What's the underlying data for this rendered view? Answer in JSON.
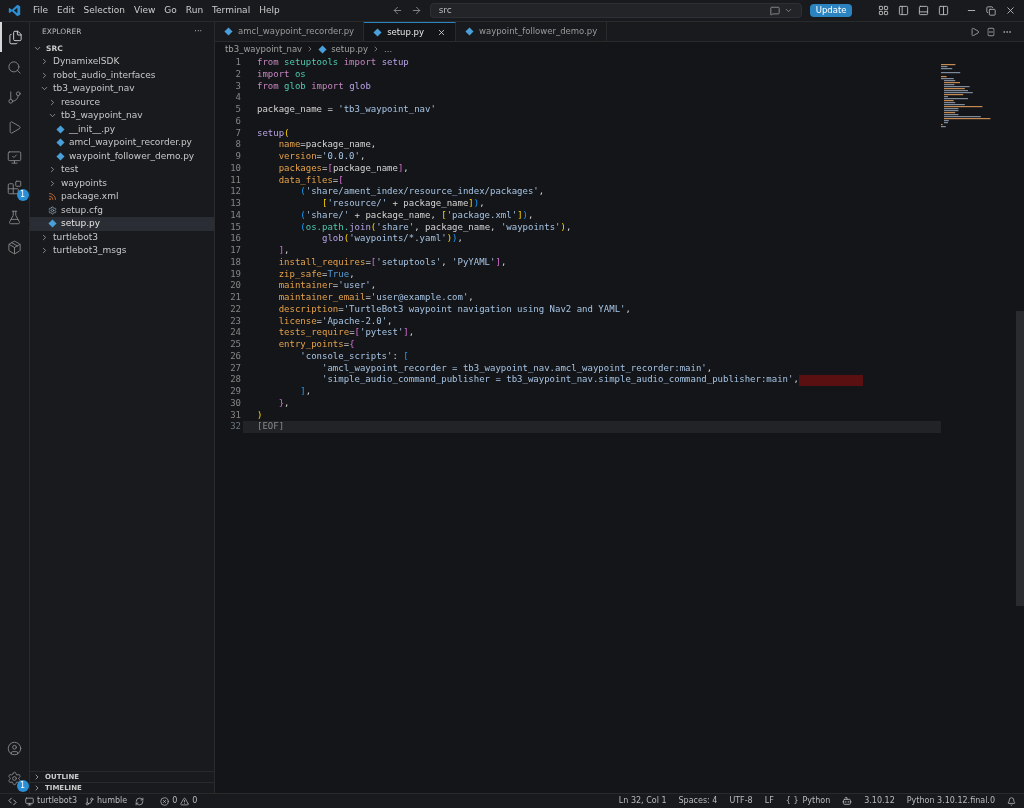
{
  "title_bar": {
    "menu": [
      "File",
      "Edit",
      "Selection",
      "View",
      "Go",
      "Run",
      "Terminal",
      "Help"
    ],
    "search": {
      "value": "src"
    },
    "update_button": "Update"
  },
  "activity_bar": {
    "badges": {
      "extensions": "1",
      "settings": "1"
    }
  },
  "explorer": {
    "title": "EXPLORER",
    "more": "···",
    "root": "SRC",
    "tree": [
      {
        "name": "DynamixelSDK",
        "kind": "folder",
        "expanded": false,
        "selected": false
      },
      {
        "name": "robot_audio_interfaces",
        "kind": "folder",
        "expanded": false,
        "selected": false
      },
      {
        "name": "tb3_waypoint_nav",
        "kind": "folder",
        "expanded": true,
        "selected": false,
        "children": [
          {
            "name": "resource",
            "kind": "folder",
            "expanded": false,
            "selected": false
          },
          {
            "name": "tb3_waypoint_nav",
            "kind": "folder",
            "expanded": true,
            "selected": false,
            "children": [
              {
                "name": "__init__.py",
                "kind": "python",
                "selected": false
              },
              {
                "name": "amcl_waypoint_recorder.py",
                "kind": "python",
                "selected": false
              },
              {
                "name": "waypoint_follower_demo.py",
                "kind": "python",
                "selected": false
              }
            ]
          },
          {
            "name": "test",
            "kind": "folder",
            "expanded": false,
            "selected": false
          },
          {
            "name": "waypoints",
            "kind": "folder",
            "expanded": false,
            "selected": false
          },
          {
            "name": "package.xml",
            "kind": "xml",
            "selected": false
          },
          {
            "name": "setup.cfg",
            "kind": "config",
            "selected": false
          },
          {
            "name": "setup.py",
            "kind": "python",
            "selected": true
          }
        ]
      },
      {
        "name": "turtlebot3",
        "kind": "folder",
        "expanded": false,
        "selected": false
      },
      {
        "name": "turtlebot3_msgs",
        "kind": "folder",
        "expanded": false,
        "selected": false
      }
    ],
    "panels": [
      "OUTLINE",
      "TIMELINE"
    ]
  },
  "tabs": [
    {
      "label": "amcl_waypoint_recorder.py",
      "selected": false
    },
    {
      "label": "setup.py",
      "selected": true
    },
    {
      "label": "waypoint_follower_demo.py",
      "selected": false
    }
  ],
  "breadcrumb": [
    "tb3_waypoint_nav",
    "setup.py",
    "..."
  ],
  "code_lines": [
    {
      "number": "1",
      "current": false,
      "error": false,
      "tokens": [
        {
          "kind": "kw",
          "text": "from "
        },
        {
          "kind": "mod",
          "text": "setuptools "
        },
        {
          "kind": "kw",
          "text": "import "
        },
        {
          "kind": "fn",
          "text": "setup"
        }
      ]
    },
    {
      "number": "2",
      "current": false,
      "error": false,
      "tokens": [
        {
          "kind": "kw",
          "text": "import "
        },
        {
          "kind": "mod",
          "text": "os"
        }
      ]
    },
    {
      "number": "3",
      "current": false,
      "error": false,
      "tokens": [
        {
          "kind": "kw",
          "text": "from "
        },
        {
          "kind": "mod",
          "text": "glob "
        },
        {
          "kind": "kw",
          "text": "import "
        },
        {
          "kind": "fn",
          "text": "glob"
        }
      ]
    },
    {
      "number": "4",
      "current": false,
      "error": false
    },
    {
      "number": "5",
      "current": false,
      "error": false,
      "tokens": [
        {
          "kind": "plain",
          "text": "package_name = "
        },
        {
          "kind": "str",
          "text": "'tb3_waypoint_nav'"
        }
      ]
    },
    {
      "number": "6",
      "current": false,
      "error": false
    },
    {
      "number": "7",
      "current": false,
      "error": false,
      "tokens": [
        {
          "kind": "fn",
          "text": "setup"
        },
        {
          "kind": "br1",
          "text": "("
        }
      ]
    },
    {
      "number": "8",
      "current": false,
      "error": false,
      "tokens": [
        {
          "kind": "param",
          "text": "    name"
        },
        {
          "kind": "plain",
          "text": "=package_name,"
        }
      ]
    },
    {
      "number": "9",
      "current": false,
      "error": false,
      "tokens": [
        {
          "kind": "param",
          "text": "    version"
        },
        {
          "kind": "plain",
          "text": "="
        },
        {
          "kind": "str",
          "text": "'0.0.0'"
        },
        {
          "kind": "plain",
          "text": ","
        }
      ]
    },
    {
      "number": "10",
      "current": false,
      "error": false,
      "tokens": [
        {
          "kind": "param",
          "text": "    packages"
        },
        {
          "kind": "plain",
          "text": "="
        },
        {
          "kind": "br2",
          "text": "["
        },
        {
          "kind": "plain",
          "text": "package_name"
        },
        {
          "kind": "br2",
          "text": "]"
        },
        {
          "kind": "plain",
          "text": ","
        }
      ]
    },
    {
      "number": "11",
      "current": false,
      "error": false,
      "tokens": [
        {
          "kind": "param",
          "text": "    data_files"
        },
        {
          "kind": "plain",
          "text": "="
        },
        {
          "kind": "br2",
          "text": "["
        }
      ]
    },
    {
      "number": "12",
      "current": false,
      "error": false,
      "tokens": [
        {
          "kind": "br3",
          "text": "        ("
        },
        {
          "kind": "str",
          "text": "'share/ament_index/resource_index/packages'"
        },
        {
          "kind": "plain",
          "text": ","
        }
      ]
    },
    {
      "number": "13",
      "current": false,
      "error": false,
      "tokens": [
        {
          "kind": "br1",
          "text": "            ["
        },
        {
          "kind": "str",
          "text": "'resource/'"
        },
        {
          "kind": "plain",
          "text": " + package_name"
        },
        {
          "kind": "br1",
          "text": "]"
        },
        {
          "kind": "br3",
          "text": ")"
        },
        {
          "kind": "plain",
          "text": ","
        }
      ]
    },
    {
      "number": "14",
      "current": false,
      "error": false,
      "tokens": [
        {
          "kind": "br3",
          "text": "        ("
        },
        {
          "kind": "str",
          "text": "'share/'"
        },
        {
          "kind": "plain",
          "text": " + package_name, "
        },
        {
          "kind": "br1",
          "text": "["
        },
        {
          "kind": "str",
          "text": "'package.xml'"
        },
        {
          "kind": "br1",
          "text": "]"
        },
        {
          "kind": "br3",
          "text": ")"
        },
        {
          "kind": "plain",
          "text": ","
        }
      ]
    },
    {
      "number": "15",
      "current": false,
      "error": false,
      "tokens": [
        {
          "kind": "br3",
          "text": "        ("
        },
        {
          "kind": "mod",
          "text": "os.path."
        },
        {
          "kind": "fn",
          "text": "join"
        },
        {
          "kind": "br1",
          "text": "("
        },
        {
          "kind": "str",
          "text": "'share'"
        },
        {
          "kind": "plain",
          "text": ", package_name, "
        },
        {
          "kind": "str",
          "text": "'waypoints'"
        },
        {
          "kind": "br1",
          "text": ")"
        },
        {
          "kind": "plain",
          "text": ","
        }
      ]
    },
    {
      "number": "16",
      "current": false,
      "error": false,
      "tokens": [
        {
          "kind": "fn",
          "text": "            glob"
        },
        {
          "kind": "br1",
          "text": "("
        },
        {
          "kind": "str",
          "text": "'waypoints/*.yaml'"
        },
        {
          "kind": "br1",
          "text": ")"
        },
        {
          "kind": "br3",
          "text": ")"
        },
        {
          "kind": "plain",
          "text": ","
        }
      ]
    },
    {
      "number": "17",
      "current": false,
      "error": false,
      "tokens": [
        {
          "kind": "br2",
          "text": "    ]"
        },
        {
          "kind": "plain",
          "text": ","
        }
      ]
    },
    {
      "number": "18",
      "current": false,
      "error": false,
      "tokens": [
        {
          "kind": "param",
          "text": "    install_requires"
        },
        {
          "kind": "plain",
          "text": "="
        },
        {
          "kind": "br2",
          "text": "["
        },
        {
          "kind": "str",
          "text": "'setuptools'"
        },
        {
          "kind": "plain",
          "text": ", "
        },
        {
          "kind": "str",
          "text": "'PyYAML'"
        },
        {
          "kind": "br2",
          "text": "]"
        },
        {
          "kind": "plain",
          "text": ","
        }
      ]
    },
    {
      "number": "19",
      "current": false,
      "error": false,
      "tokens": [
        {
          "kind": "param",
          "text": "    zip_safe"
        },
        {
          "kind": "plain",
          "text": "="
        },
        {
          "kind": "const",
          "text": "True"
        },
        {
          "kind": "plain",
          "text": ","
        }
      ]
    },
    {
      "number": "20",
      "current": false,
      "error": false,
      "tokens": [
        {
          "kind": "param",
          "text": "    maintainer"
        },
        {
          "kind": "plain",
          "text": "="
        },
        {
          "kind": "str",
          "text": "'user'"
        },
        {
          "kind": "plain",
          "text": ","
        }
      ]
    },
    {
      "number": "21",
      "current": false,
      "error": false,
      "tokens": [
        {
          "kind": "param",
          "text": "    maintainer_email"
        },
        {
          "kind": "plain",
          "text": "="
        },
        {
          "kind": "str",
          "text": "'user@example.com'"
        },
        {
          "kind": "plain",
          "text": ","
        }
      ]
    },
    {
      "number": "22",
      "current": false,
      "error": false,
      "tokens": [
        {
          "kind": "param",
          "text": "    description"
        },
        {
          "kind": "plain",
          "text": "="
        },
        {
          "kind": "str",
          "text": "'TurtleBot3 waypoint navigation using Nav2 and YAML'"
        },
        {
          "kind": "plain",
          "text": ","
        }
      ]
    },
    {
      "number": "23",
      "current": false,
      "error": false,
      "tokens": [
        {
          "kind": "param",
          "text": "    license"
        },
        {
          "kind": "plain",
          "text": "="
        },
        {
          "kind": "str",
          "text": "'Apache-2.0'"
        },
        {
          "kind": "plain",
          "text": ","
        }
      ]
    },
    {
      "number": "24",
      "current": false,
      "error": false,
      "tokens": [
        {
          "kind": "param",
          "text": "    tests_require"
        },
        {
          "kind": "plain",
          "text": "="
        },
        {
          "kind": "br2",
          "text": "["
        },
        {
          "kind": "str",
          "text": "'pytest'"
        },
        {
          "kind": "br2",
          "text": "]"
        },
        {
          "kind": "plain",
          "text": ","
        }
      ]
    },
    {
      "number": "25",
      "current": false,
      "error": false,
      "tokens": [
        {
          "kind": "param",
          "text": "    entry_points"
        },
        {
          "kind": "plain",
          "text": "="
        },
        {
          "kind": "br2",
          "text": "{"
        }
      ]
    },
    {
      "number": "26",
      "current": false,
      "error": false,
      "tokens": [
        {
          "kind": "str",
          "text": "        'console_scripts'"
        },
        {
          "kind": "plain",
          "text": ": "
        },
        {
          "kind": "br3",
          "text": "["
        }
      ]
    },
    {
      "number": "27",
      "current": false,
      "error": false,
      "tokens": [
        {
          "kind": "str",
          "text": "            'amcl_waypoint_recorder = tb3_waypoint_nav.amcl_waypoint_recorder:main'"
        },
        {
          "kind": "plain",
          "text": ","
        }
      ]
    },
    {
      "number": "28",
      "current": false,
      "error": true,
      "tokens": [
        {
          "kind": "str",
          "text": "            'simple_audio_command_publisher = tb3_waypoint_nav.simple_audio_command_publisher:main'"
        },
        {
          "kind": "plain",
          "text": ","
        }
      ]
    },
    {
      "number": "29",
      "current": false,
      "error": false,
      "tokens": [
        {
          "kind": "br3",
          "text": "        ]"
        },
        {
          "kind": "plain",
          "text": ","
        }
      ]
    },
    {
      "number": "30",
      "current": false,
      "error": false,
      "tokens": [
        {
          "kind": "br2",
          "text": "    }"
        },
        {
          "kind": "plain",
          "text": ","
        }
      ]
    },
    {
      "number": "31",
      "current": false,
      "error": false,
      "tokens": [
        {
          "kind": "br1",
          "text": ")"
        }
      ]
    },
    {
      "number": "32",
      "current": true,
      "error": false,
      "tokens": [
        {
          "kind": "dim",
          "text": "[EOF]"
        }
      ]
    }
  ],
  "status_bar": {
    "remote": "turtlebot3",
    "branch": "humble",
    "errors": "0",
    "warnings": "0",
    "position": "Ln 32, Col 1",
    "spaces": "Spaces: 4",
    "encoding": "UTF-8",
    "eol": "LF",
    "language_braces": "{ }",
    "language": "Python",
    "version": "3.10.12",
    "interpreter": "Python 3.10.12.final.0"
  }
}
